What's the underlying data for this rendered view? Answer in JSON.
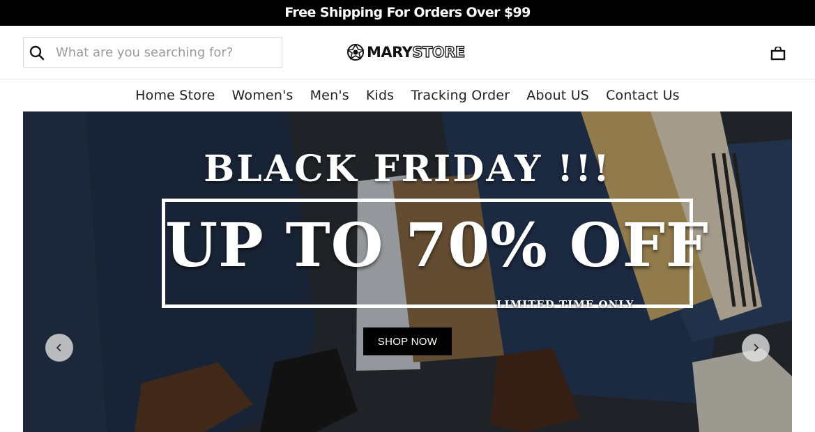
{
  "announcement": {
    "text": "Free Shipping For Orders Over $99"
  },
  "header": {
    "search_placeholder": "What are you searching for?",
    "logo": {
      "part1": "MARY",
      "part2": "STORE"
    },
    "cart_icon": "shopping-bag-icon"
  },
  "nav": {
    "items": [
      {
        "label": "Home Store"
      },
      {
        "label": "Women's"
      },
      {
        "label": "Men's"
      },
      {
        "label": "Kids"
      },
      {
        "label": "Tracking Order"
      },
      {
        "label": "About US"
      },
      {
        "label": "Contact Us"
      }
    ]
  },
  "hero": {
    "headline": "BLACK FRIDAY !!!",
    "offer": "UP TO 70% OFF",
    "subtext": "LIMITED TIME ONLY",
    "button_label": "SHOP NOW",
    "prev_icon": "chevron-left-icon",
    "next_icon": "chevron-right-icon"
  },
  "colors": {
    "announcement_bg": "#000000",
    "button_bg": "#000000",
    "text": "#222222"
  }
}
